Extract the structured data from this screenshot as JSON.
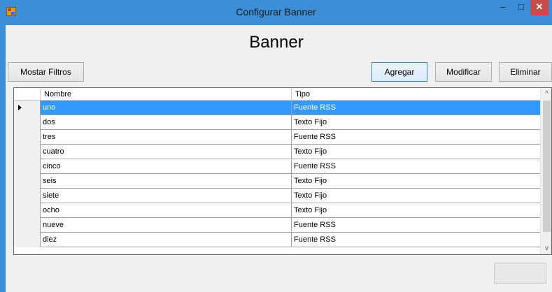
{
  "window": {
    "title": "Configurar Banner",
    "controls": {
      "minimize": "–",
      "maximize": "□",
      "close": "✕"
    }
  },
  "heading": "Banner",
  "toolbar": {
    "filters_label": "Mostar Filtros",
    "add_label": "Agregar",
    "modify_label": "Modificar",
    "delete_label": "Eliminar"
  },
  "grid": {
    "columns": [
      "Nombre",
      "Tipo"
    ],
    "selected_row": 0,
    "rows": [
      {
        "nombre": "uno",
        "tipo": "Fuente RSS"
      },
      {
        "nombre": "dos",
        "tipo": "Texto Fijo"
      },
      {
        "nombre": "tres",
        "tipo": "Fuente RSS"
      },
      {
        "nombre": "cuatro",
        "tipo": "Texto Fijo"
      },
      {
        "nombre": "cinco",
        "tipo": "Fuente RSS"
      },
      {
        "nombre": "seis",
        "tipo": "Texto Fijo"
      },
      {
        "nombre": "siete",
        "tipo": "Texto Fijo"
      },
      {
        "nombre": "ocho",
        "tipo": "Texto Fijo"
      },
      {
        "nombre": "nueve",
        "tipo": "Fuente RSS"
      },
      {
        "nombre": "diez",
        "tipo": "Fuente RSS"
      }
    ],
    "scroll": {
      "up": "^",
      "down": "v"
    }
  },
  "bottom_button_label": ""
}
